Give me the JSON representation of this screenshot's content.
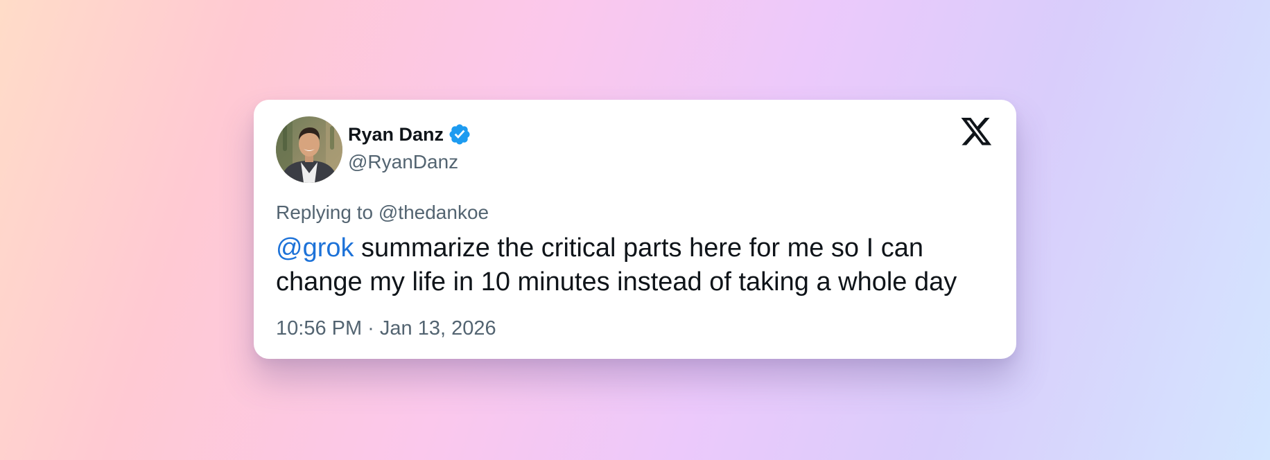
{
  "tweet": {
    "author": {
      "display_name": "Ryan Danz",
      "handle": "@RyanDanz",
      "verified": true,
      "avatar_icon": "profile-photo"
    },
    "reply": {
      "prefix": "Replying to ",
      "to": "@thedankoe"
    },
    "body": {
      "mention": "@grok",
      "text": " summarize the critical parts here for me so I can change my life in 10 minutes instead of taking a whole day"
    },
    "timestamp": "10:56 PM · Jan 13, 2026",
    "platform_icon": "x-logo-icon"
  },
  "colors": {
    "verified_badge": "#1d9bf0",
    "mention_link": "#1d72d8",
    "secondary_text": "#536471",
    "primary_text": "#0f1419",
    "card_background": "#ffffff"
  }
}
